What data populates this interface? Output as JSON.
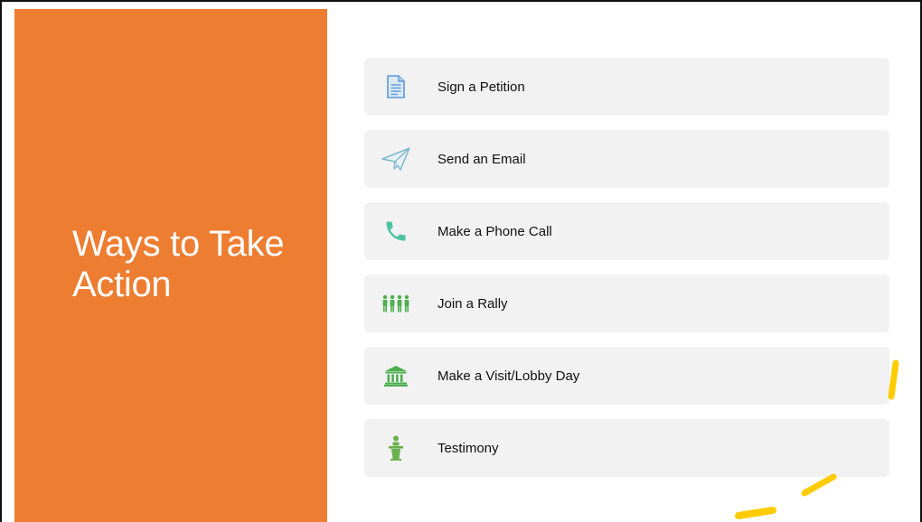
{
  "slide": {
    "title": "Ways to Take Action",
    "accent_color": "#ed7d31",
    "highlight_color": "#ffcc00"
  },
  "actions": [
    {
      "label": "Sign a Petition",
      "icon": "document-icon",
      "icon_color": "#5b9bd5"
    },
    {
      "label": "Send an Email",
      "icon": "paper-plane-icon",
      "icon_color": "#7fb8c9"
    },
    {
      "label": "Make a Phone Call",
      "icon": "phone-icon",
      "icon_color": "#4fc3a1"
    },
    {
      "label": "Join a Rally",
      "icon": "people-group-icon",
      "icon_color": "#4caf50"
    },
    {
      "label": "Make a Visit/Lobby Day",
      "icon": "government-building-icon",
      "icon_color": "#4caf50"
    },
    {
      "label": "Testimony",
      "icon": "podium-speaker-icon",
      "icon_color": "#6ab04c"
    }
  ]
}
